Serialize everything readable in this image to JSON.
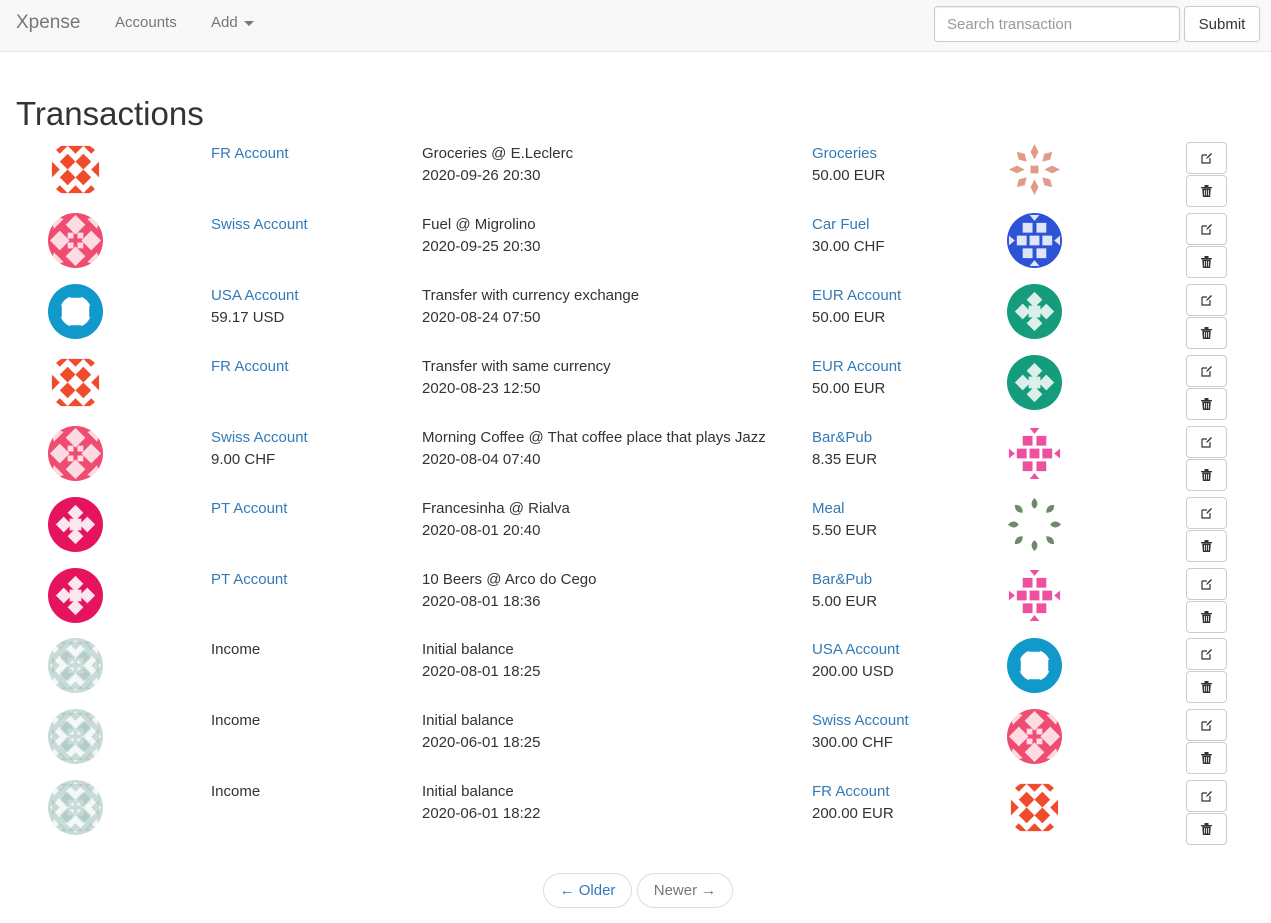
{
  "navbar": {
    "brand": "Xpense",
    "accounts_label": "Accounts",
    "add_label": "Add",
    "search_placeholder": "Search transaction",
    "submit_label": "Submit"
  },
  "page": {
    "title": "Transactions"
  },
  "colors": {
    "fr": "#f14b2d",
    "swiss": "#ee4d71",
    "usa": "#1199cc",
    "pt": "#e6135f",
    "eur": "#149c7c",
    "income": "#9dbdb8",
    "groceries": "#dc8a73",
    "carfuel": "#2d52d6",
    "barpub": "#ef4f9f",
    "meal": "#6e8a6a",
    "link": "#337ab7"
  },
  "transactions": [
    {
      "from": "FR Account",
      "from_amount": "",
      "description": "Groceries @ E.Leclerc",
      "datetime": "2020-09-26 20:30",
      "to": "Groceries",
      "to_amount": "50.00 EUR"
    },
    {
      "from": "Swiss Account",
      "from_amount": "",
      "description": "Fuel @ Migrolino",
      "datetime": "2020-09-25 20:30",
      "to": "Car Fuel",
      "to_amount": "30.00 CHF"
    },
    {
      "from": "USA Account",
      "from_amount": "59.17 USD",
      "description": "Transfer with currency exchange",
      "datetime": "2020-08-24 07:50",
      "to": "EUR Account",
      "to_amount": "50.00 EUR"
    },
    {
      "from": "FR Account",
      "from_amount": "",
      "description": "Transfer with same currency",
      "datetime": "2020-08-23 12:50",
      "to": "EUR Account",
      "to_amount": "50.00 EUR"
    },
    {
      "from": "Swiss Account",
      "from_amount": "9.00 CHF",
      "description": "Morning Coffee @ That coffee place that plays Jazz",
      "datetime": "2020-08-04 07:40",
      "to": "Bar&Pub",
      "to_amount": "8.35 EUR"
    },
    {
      "from": "PT Account",
      "from_amount": "",
      "description": "Francesinha @ Rialva",
      "datetime": "2020-08-01 20:40",
      "to": "Meal",
      "to_amount": "5.50 EUR"
    },
    {
      "from": "PT Account",
      "from_amount": "",
      "description": "10 Beers @ Arco do Cego",
      "datetime": "2020-08-01 18:36",
      "to": "Bar&Pub",
      "to_amount": "5.00 EUR"
    },
    {
      "from": "Income",
      "from_amount": "",
      "description": "Initial balance",
      "datetime": "2020-08-01 18:25",
      "to": "USA Account",
      "to_amount": "200.00 USD"
    },
    {
      "from": "Income",
      "from_amount": "",
      "description": "Initial balance",
      "datetime": "2020-06-01 18:25",
      "to": "Swiss Account",
      "to_amount": "300.00 CHF"
    },
    {
      "from": "Income",
      "from_amount": "",
      "description": "Initial balance",
      "datetime": "2020-06-01 18:22",
      "to": "FR Account",
      "to_amount": "200.00 EUR"
    }
  ],
  "icons": {
    "edit": "edit-icon",
    "delete": "trash-icon"
  },
  "pager": {
    "older_label": "← Older",
    "newer_label": "Newer →"
  }
}
